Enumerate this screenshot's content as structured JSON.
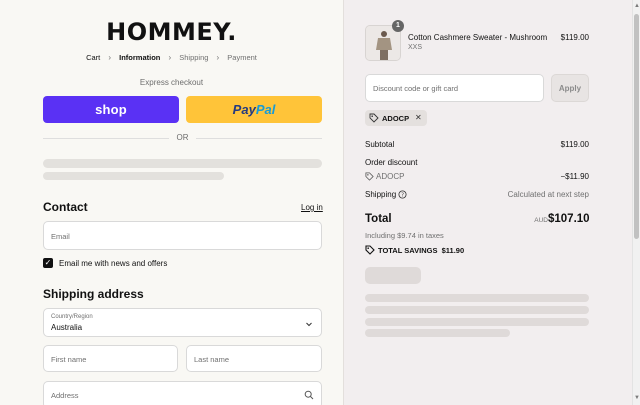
{
  "brand": {
    "logo": "HOMMEY."
  },
  "breadcrumb": {
    "items": [
      "Cart",
      "Information",
      "Shipping",
      "Payment"
    ],
    "separator": "›"
  },
  "express": {
    "label": "Express checkout",
    "shop_label": "shop",
    "paypal_part1": "Pay",
    "paypal_part2": "Pal",
    "or_label": "OR"
  },
  "contact": {
    "title": "Contact",
    "login_label": "Log in",
    "email_placeholder": "Email",
    "newsletter_label": "Email me with news and offers",
    "newsletter_checked": true
  },
  "shipping": {
    "title": "Shipping address",
    "country_label": "Country/Region",
    "country_value": "Australia",
    "first_name_placeholder": "First name",
    "last_name_placeholder": "Last name",
    "address_placeholder": "Address"
  },
  "order": {
    "product": {
      "name": "Cotton Cashmere Sweater - Mushroom",
      "variant": "XXS",
      "price": "$119.00",
      "quantity": "1"
    },
    "discount_placeholder": "Discount code or gift card",
    "apply_label": "Apply",
    "applied_code": "ADOCP",
    "subtotal_label": "Subtotal",
    "subtotal_value": "$119.00",
    "order_discount_label": "Order discount",
    "discount_code": "ADOCP",
    "discount_value": "−$11.90",
    "shipping_label": "Shipping",
    "shipping_value": "Calculated at next step",
    "total_label": "Total",
    "total_currency": "AUD",
    "total_value": "$107.10",
    "taxes_note": "Including $9.74 in taxes",
    "savings_label": "TOTAL SAVINGS",
    "savings_value": "$11.90"
  },
  "colors": {
    "shop_purple": "#5a31f4",
    "paypal_yellow": "#ffc439",
    "left_bg": "#f9f8f4",
    "right_bg": "#f2eeef"
  },
  "icons": [
    "chevron-right-icon",
    "chevron-down-icon",
    "search-icon",
    "tag-icon",
    "close-icon",
    "help-circle-icon",
    "check-icon",
    "notification-badge"
  ]
}
